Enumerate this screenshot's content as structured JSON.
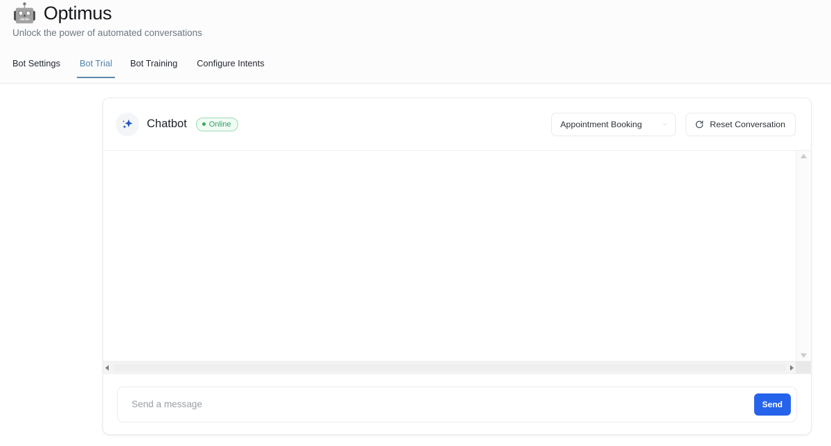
{
  "header": {
    "logo_icon": "robot-emoji",
    "logo_glyph": "🤖",
    "title": "Optimus",
    "subtitle": "Unlock the power of automated conversations"
  },
  "tabs": [
    {
      "label": "Bot Settings",
      "active": false
    },
    {
      "label": "Bot Trial",
      "active": true
    },
    {
      "label": "Bot Training",
      "active": false
    },
    {
      "label": "Configure Intents",
      "active": false
    }
  ],
  "chat": {
    "bot_icon": "sparkles-icon",
    "bot_name": "Chatbot",
    "status_label": "Online",
    "intent_select": {
      "value": "Appointment Booking",
      "chevron_icon": "chevron-down-icon"
    },
    "reset_button": {
      "label": "Reset Conversation",
      "icon": "refresh-icon"
    },
    "messages": [],
    "scrollbars": {
      "vertical": {
        "up_icon": "arrow-up-icon",
        "down_icon": "arrow-down-icon"
      },
      "horizontal": {
        "left_icon": "arrow-left-icon",
        "right_icon": "arrow-right-icon"
      }
    }
  },
  "composer": {
    "input_value": "",
    "input_placeholder": "Send a message",
    "send_label": "Send"
  },
  "colors": {
    "accent_blue": "#2563eb",
    "tab_active": "#5083a8",
    "status_green": "#2f9e63",
    "page_bg": "#ffffff",
    "header_bg": "#fcfcfd"
  }
}
